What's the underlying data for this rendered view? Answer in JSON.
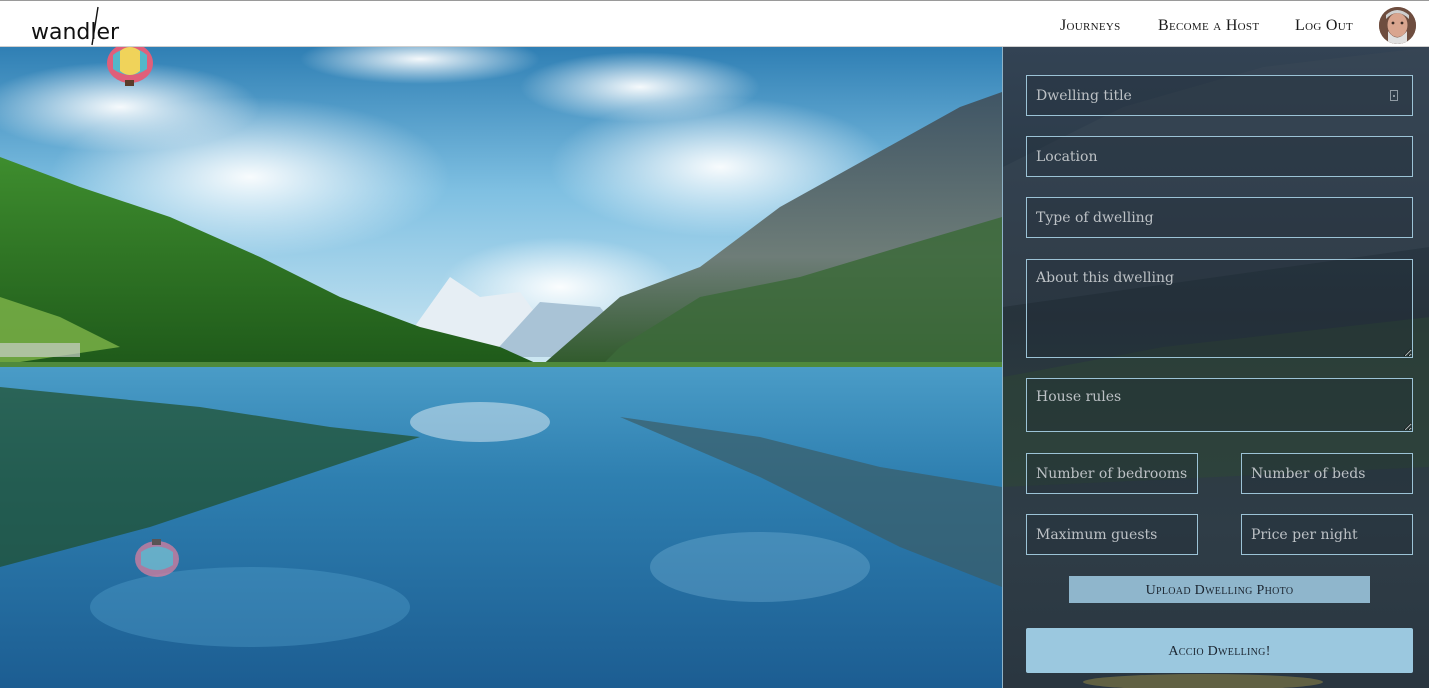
{
  "header": {
    "logo_text": "wandler",
    "nav": [
      {
        "label": "Journeys"
      },
      {
        "label": "Become a Host"
      },
      {
        "label": "Log Out"
      }
    ]
  },
  "form": {
    "title_placeholder": "Dwelling title",
    "location_placeholder": "Location",
    "type_placeholder": "Type of dwelling",
    "about_placeholder": "About this dwelling",
    "rules_placeholder": "House rules",
    "bedrooms_placeholder": "Number of bedrooms",
    "beds_placeholder": "Number of beds",
    "guests_placeholder": "Maximum guests",
    "price_placeholder": "Price per night",
    "upload_label": "Upload Dwelling Photo",
    "submit_label": "Accio Dwelling!"
  },
  "colors": {
    "accent": "#9bc8df",
    "field_border": "#9cc3d6",
    "panel_bg": "#2c3b49"
  },
  "icons": [
    "avatar",
    "hot-air-balloon",
    "password-manager-icon"
  ]
}
